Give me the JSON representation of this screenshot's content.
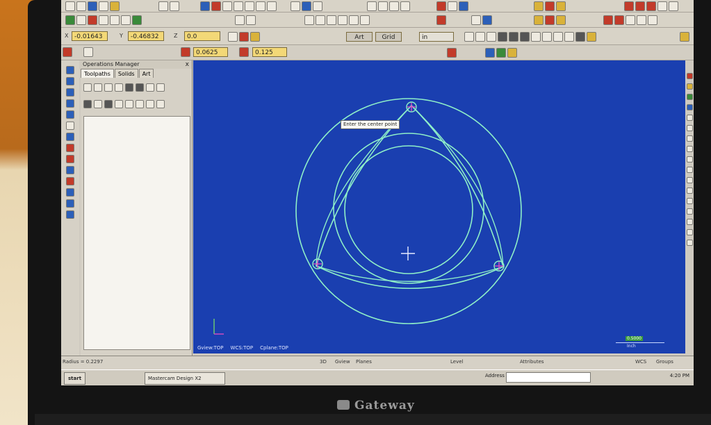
{
  "coords": {
    "x_value": "-0.01643",
    "y_value": "-0.46832",
    "z_value": "0.0"
  },
  "attribute_bar": {
    "art_button": "Art",
    "grid_button": "Grid",
    "units_value": "in"
  },
  "tolerance": {
    "value_a": "0.0625",
    "value_b": "0.125"
  },
  "operations_manager": {
    "title": "Operations Manager",
    "close": "x",
    "tabs": [
      "Toolpaths",
      "Solids",
      "Art"
    ]
  },
  "viewport": {
    "tooltip": "Enter the center point",
    "status": [
      "Gview:TOP",
      "WCS:TOP",
      "Cplane:TOP"
    ],
    "scale_value": "0.5000",
    "scale_unit": "Inch"
  },
  "statusbar": {
    "radius": "Radius = 0.2297",
    "mode": "3D",
    "gview": "Gview",
    "planes": "Planes",
    "level": "Level",
    "attributes": "Attributes",
    "wcs": "WCS",
    "groups": "Groups"
  },
  "taskbar": {
    "start": "start",
    "task": "Mastercam Design X2",
    "address": "Address",
    "clock": "4:20 PM"
  },
  "laptop": {
    "brand": "Gateway"
  },
  "colors": {
    "viewport_bg": "#1a3fb0",
    "geometry": "#8ff0c8",
    "marker": "#d94cc0",
    "field_yellow": "#f3d877"
  }
}
